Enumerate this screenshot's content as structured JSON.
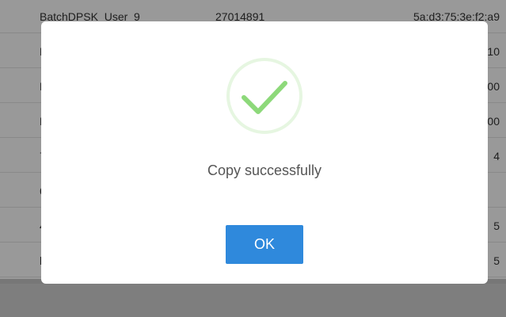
{
  "table": {
    "rows": [
      {
        "name": "BatchDPSK_User_9",
        "id": "27014891",
        "mac": "5a:d3:75:3e:f2:a9"
      },
      {
        "name": "E",
        "id": "",
        "mac": "10"
      },
      {
        "name": "E",
        "id": "",
        "mac": "00"
      },
      {
        "name": "E",
        "id": "",
        "mac": "00"
      },
      {
        "name": "7",
        "id": "",
        "mac": "4"
      },
      {
        "name": "6",
        "id": "",
        "mac": ""
      },
      {
        "name": "4",
        "id": "",
        "mac": "5"
      },
      {
        "name": "l",
        "id": "",
        "mac": "5"
      }
    ]
  },
  "dialog": {
    "icon": "check-circle-icon",
    "message": "Copy successfully",
    "ok_label": "OK",
    "colors": {
      "check": "#8dd97a",
      "ring": "#e6f6e1",
      "button": "#2f89dc"
    }
  }
}
